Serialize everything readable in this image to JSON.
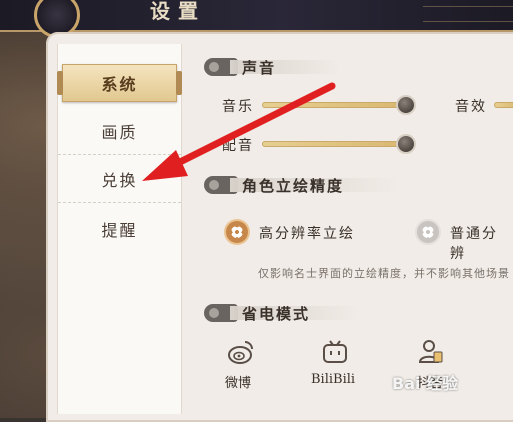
{
  "header": {
    "title": "设置"
  },
  "menu": {
    "items": [
      {
        "label": "系统",
        "active": true
      },
      {
        "label": "画质",
        "active": false
      },
      {
        "label": "兑换",
        "active": false
      },
      {
        "label": "提醒",
        "active": false
      }
    ]
  },
  "sound": {
    "header": "声音",
    "music_label": "音乐",
    "music_level": 1.0,
    "effects_label": "音效",
    "voice_label": "配音",
    "voice_level": 1.0
  },
  "portrait": {
    "header": "角色立绘精度",
    "options": [
      {
        "label": "高分辨率立绘",
        "selected": true
      },
      {
        "label": "普通分辨",
        "selected": false
      }
    ],
    "note": "仅影响名士界面的立绘精度，并不影响其他场景"
  },
  "power": {
    "header": "省电模式"
  },
  "share": {
    "items": [
      {
        "label": "微博",
        "icon": "weibo-icon"
      },
      {
        "label": "BiliBili",
        "icon": "bilibili-icon"
      },
      {
        "label": "抖音",
        "icon": "douyin-icon"
      }
    ]
  },
  "watermark": {
    "text": "Bai 经验"
  },
  "annotation": {
    "color": "#e02020",
    "target": "兑换"
  }
}
